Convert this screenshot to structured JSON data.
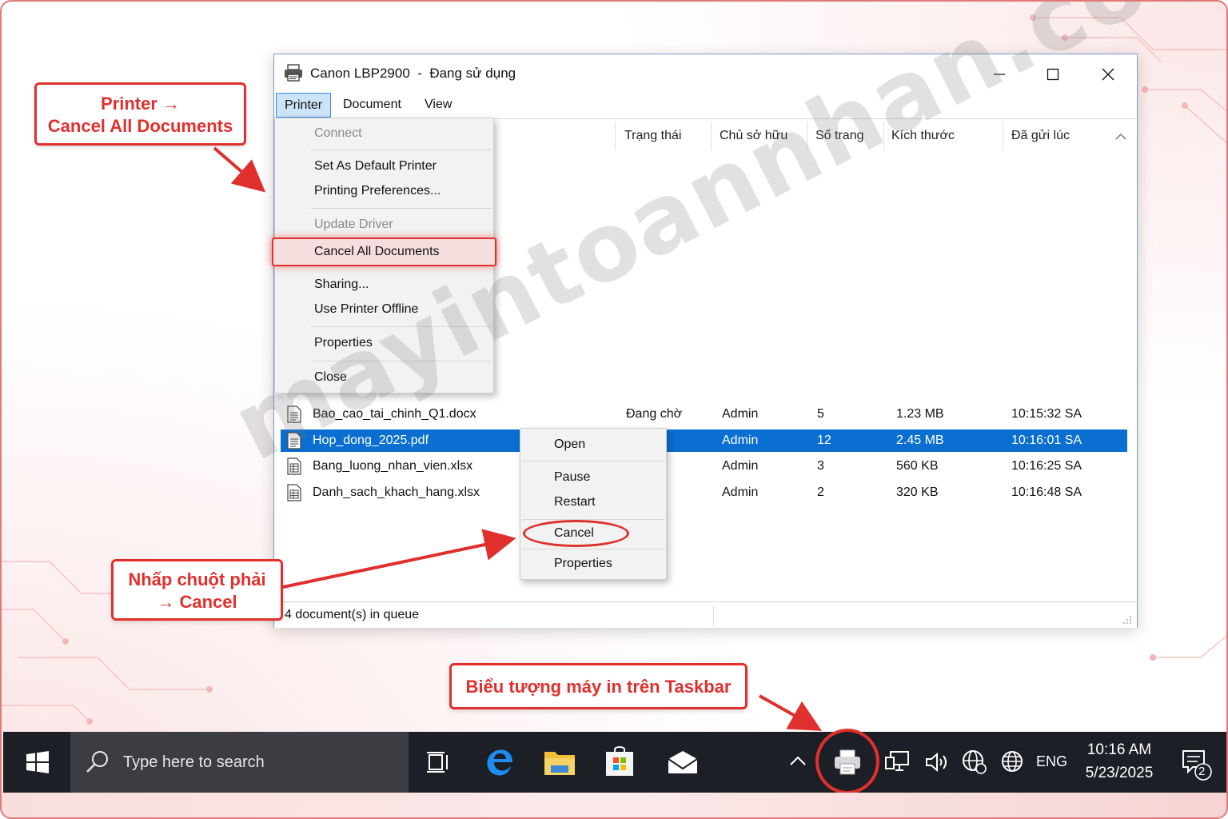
{
  "window": {
    "title": "Canon LBP2900  -  Đang sử dụng",
    "menu": [
      "Printer",
      "Document",
      "View"
    ],
    "columns": [
      "Trạng thái",
      "Chủ sở hữu",
      "Số trang",
      "Kích thước",
      "Đã gửi lúc"
    ],
    "rows": [
      {
        "name": "Bao_cao_tai_chinh_Q1.docx",
        "status": "Đang chờ",
        "owner": "Admin",
        "pages": "5",
        "size": "1.23 MB",
        "time": "10:15:32 SA"
      },
      {
        "name": "Hop_dong_2025.pdf",
        "status": "",
        "owner": "Admin",
        "pages": "12",
        "size": "2.45 MB",
        "time": "10:16:01 SA"
      },
      {
        "name": "Bang_luong_nhan_vien.xlsx",
        "status": "",
        "owner": "Admin",
        "pages": "3",
        "size": "560 KB",
        "time": "10:16:25 SA"
      },
      {
        "name": "Danh_sach_khach_hang.xlsx",
        "status": "",
        "owner": "Admin",
        "pages": "2",
        "size": "320 KB",
        "time": "10:16:48 SA"
      }
    ],
    "status": "4 document(s) in queue"
  },
  "printer_menu": {
    "connect": "Connect",
    "set_default": "Set As Default Printer",
    "preferences": "Printing Preferences...",
    "update_driver": "Update Driver",
    "cancel_all": "Cancel All Documents",
    "sharing": "Sharing...",
    "offline": "Use Printer Offline",
    "properties": "Properties",
    "close": "Close"
  },
  "context_menu": {
    "open": "Open",
    "pause": "Pause",
    "restart": "Restart",
    "cancel": "Cancel",
    "properties": "Properties"
  },
  "callouts": {
    "menu_line1": "Printer →",
    "menu_line2": "Cancel All Documents",
    "right_click_line1": "Nhấp chuột phải",
    "right_click_line2": "→ Cancel",
    "taskbar": "Biểu tượng máy in trên Taskbar"
  },
  "watermark": "mayintoannhan.com",
  "taskbar": {
    "search_placeholder": "Type here to search",
    "language": "ENG",
    "time": "10:16 AM",
    "date": "5/23/2025",
    "notification_count": "2"
  },
  "colors": {
    "accent_red": "#e0302e",
    "selection_blue": "#0a6fd1",
    "taskbar": "#1c1f26"
  },
  "icons": [
    "printer-icon",
    "minimize-icon",
    "maximize-icon",
    "close-icon",
    "document-icon",
    "windows-logo-icon",
    "search-icon",
    "task-view-icon",
    "edge-icon",
    "file-explorer-icon",
    "store-icon",
    "mail-icon",
    "chevron-up-icon",
    "network-icon",
    "volume-icon",
    "globe-icon",
    "notification-icon"
  ]
}
